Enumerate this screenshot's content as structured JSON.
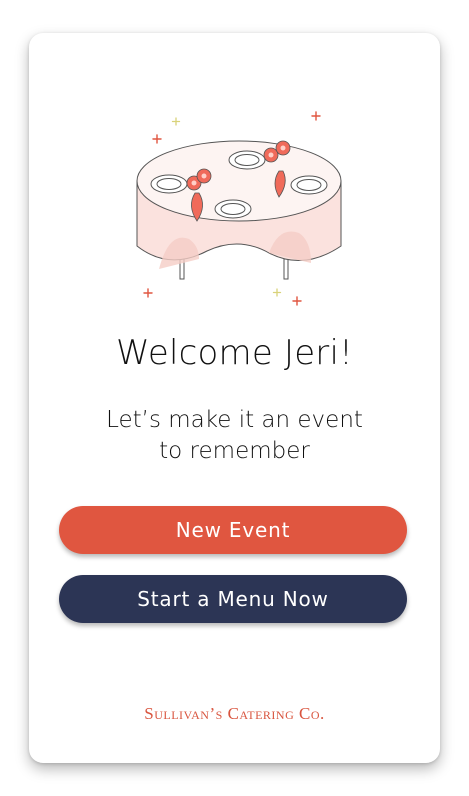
{
  "colors": {
    "primary_button": "#e05640",
    "secondary_button": "#2c3555",
    "brand_text": "#d9553f",
    "tablecloth": "#fbe2de",
    "flower": "#f06a5a"
  },
  "illustration": {
    "icon": "catering-table-illustration"
  },
  "welcome": {
    "title": "Welcome Jeri!",
    "subtitle_line1": "Let’s make it an event",
    "subtitle_line2": "to remember"
  },
  "actions": {
    "new_event_label": "New Event",
    "start_menu_label": "Start a Menu Now"
  },
  "footer": {
    "brand": "Sullivan’s Catering Co."
  }
}
